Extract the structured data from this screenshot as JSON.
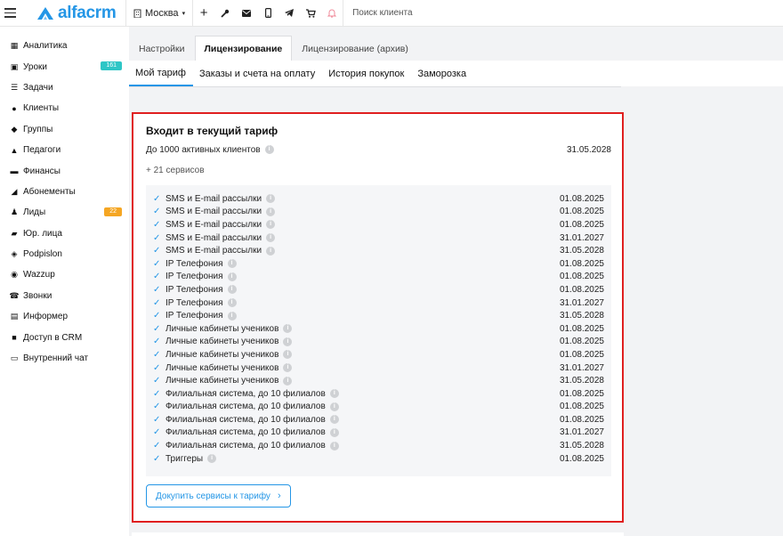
{
  "header": {
    "logo_text": "alfacrm",
    "city": "Москва",
    "search_placeholder": "Поиск клиента",
    "brand_color": "#2496e6"
  },
  "sidebar": {
    "items": [
      {
        "label": "Аналитика",
        "icon": "analytics-icon"
      },
      {
        "label": "Уроки",
        "icon": "calendar-icon",
        "badge": "161",
        "badge_color": "#2ec6c6"
      },
      {
        "label": "Задачи",
        "icon": "tasks-icon"
      },
      {
        "label": "Клиенты",
        "icon": "client-icon"
      },
      {
        "label": "Группы",
        "icon": "groups-icon"
      },
      {
        "label": "Педагоги",
        "icon": "teacher-icon"
      },
      {
        "label": "Финансы",
        "icon": "finance-icon"
      },
      {
        "label": "Абонементы",
        "icon": "tag-icon"
      },
      {
        "label": "Лиды",
        "icon": "leads-icon",
        "badge": "22",
        "badge_color": "#f5a623"
      },
      {
        "label": "Юр. лица",
        "icon": "truck-icon"
      },
      {
        "label": "Podpislon",
        "icon": "podpislon-icon"
      },
      {
        "label": "Wazzup",
        "icon": "whatsapp-icon"
      },
      {
        "label": "Звонки",
        "icon": "phone-icon"
      },
      {
        "label": "Информер",
        "icon": "informer-icon"
      },
      {
        "label": "Доступ в CRM",
        "icon": "lock-icon"
      },
      {
        "label": "Внутренний чат",
        "icon": "chat-icon"
      }
    ]
  },
  "tabs": [
    "Настройки",
    "Лицензирование",
    "Лицензирование (архив)"
  ],
  "subtabs": [
    "Мой тариф",
    "Заказы и счета на оплату",
    "История покупок",
    "Заморозка"
  ],
  "card": {
    "title": "Входит в текущий тариф",
    "plan": "До 1000 активных клиентов",
    "plan_date": "31.05.2028",
    "services_count": "+ 21 сервисов",
    "services": [
      {
        "name": "SMS и E-mail рассылки",
        "date": "01.08.2025"
      },
      {
        "name": "SMS и E-mail рассылки",
        "date": "01.08.2025"
      },
      {
        "name": "SMS и E-mail рассылки",
        "date": "01.08.2025"
      },
      {
        "name": "SMS и E-mail рассылки",
        "date": "31.01.2027"
      },
      {
        "name": "SMS и E-mail рассылки",
        "date": "31.05.2028"
      },
      {
        "name": "IP Телефония",
        "date": "01.08.2025"
      },
      {
        "name": "IP Телефония",
        "date": "01.08.2025"
      },
      {
        "name": "IP Телефония",
        "date": "01.08.2025"
      },
      {
        "name": "IP Телефония",
        "date": "31.01.2027"
      },
      {
        "name": "IP Телефония",
        "date": "31.05.2028"
      },
      {
        "name": "Личные кабинеты учеников",
        "date": "01.08.2025"
      },
      {
        "name": "Личные кабинеты учеников",
        "date": "01.08.2025"
      },
      {
        "name": "Личные кабинеты учеников",
        "date": "01.08.2025"
      },
      {
        "name": "Личные кабинеты учеников",
        "date": "31.01.2027"
      },
      {
        "name": "Личные кабинеты учеников",
        "date": "31.05.2028"
      },
      {
        "name": "Филиальная система, до 10 филиалов",
        "date": "01.08.2025"
      },
      {
        "name": "Филиальная система, до 10 филиалов",
        "date": "01.08.2025"
      },
      {
        "name": "Филиальная система, до 10 филиалов",
        "date": "01.08.2025"
      },
      {
        "name": "Филиальная система, до 10 филиалов",
        "date": "31.01.2027"
      },
      {
        "name": "Филиальная система, до 10 филиалов",
        "date": "31.05.2028"
      },
      {
        "name": "Триггеры",
        "date": "01.08.2025"
      }
    ],
    "buy_button": "Докупить сервисы к тарифу",
    "highlight_color": "#e01f1f"
  }
}
